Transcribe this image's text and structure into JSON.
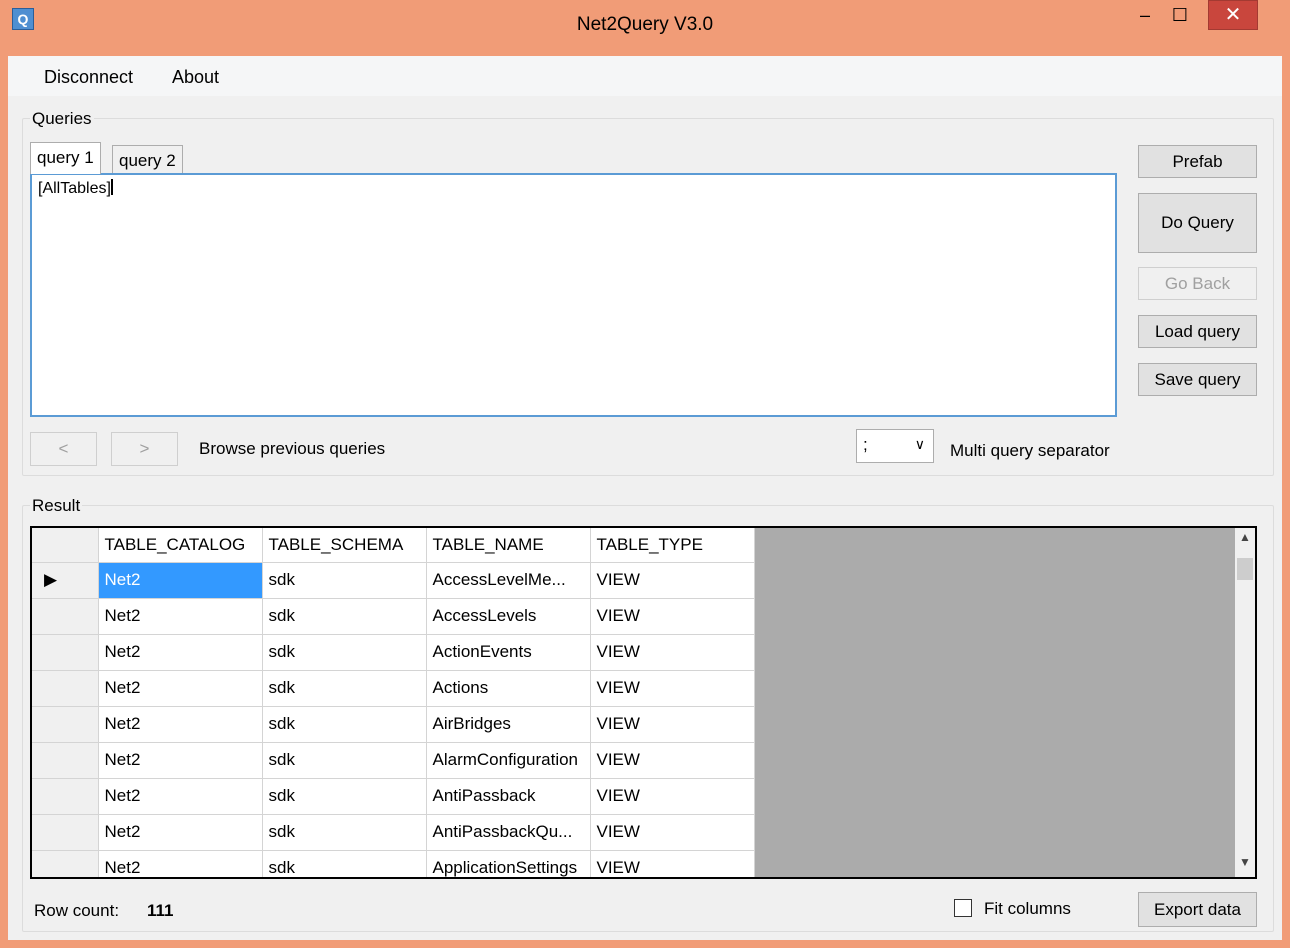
{
  "window": {
    "title": "Net2Query V3.0",
    "icon_letter": "Q",
    "min_glyph": "–",
    "max_glyph": "☐",
    "close_glyph": "✕"
  },
  "menu": {
    "items": [
      "Disconnect",
      "About"
    ]
  },
  "queries": {
    "group_label": "Queries",
    "tabs": [
      "query 1",
      "query 2"
    ],
    "active_tab": 0,
    "editor_text": "[AllTables]",
    "buttons": {
      "prefab": "Prefab",
      "do_query": "Do Query",
      "go_back": "Go Back",
      "load_query": "Load query",
      "save_query": "Save query"
    },
    "nav": {
      "prev": "<",
      "next": ">",
      "label": "Browse previous queries"
    },
    "separator": {
      "value": ";",
      "label": "Multi query separator"
    }
  },
  "result": {
    "group_label": "Result",
    "columns": [
      "TABLE_CATALOG",
      "TABLE_SCHEMA",
      "TABLE_NAME",
      "TABLE_TYPE"
    ],
    "rows": [
      [
        "Net2",
        "sdk",
        "AccessLevelMe...",
        "VIEW"
      ],
      [
        "Net2",
        "sdk",
        "AccessLevels",
        "VIEW"
      ],
      [
        "Net2",
        "sdk",
        "ActionEvents",
        "VIEW"
      ],
      [
        "Net2",
        "sdk",
        "Actions",
        "VIEW"
      ],
      [
        "Net2",
        "sdk",
        "AirBridges",
        "VIEW"
      ],
      [
        "Net2",
        "sdk",
        "AlarmConfiguration",
        "VIEW"
      ],
      [
        "Net2",
        "sdk",
        "AntiPassback",
        "VIEW"
      ],
      [
        "Net2",
        "sdk",
        "AntiPassbackQu...",
        "VIEW"
      ],
      [
        "Net2",
        "sdk",
        "ApplicationSettings",
        "VIEW"
      ]
    ],
    "current_row_marker": "▶",
    "row_count_label": "Row count:",
    "row_count": "111",
    "fit_columns_label": "Fit columns",
    "fit_columns_checked": false,
    "export_label": "Export data"
  },
  "colors": {
    "title_bar": "#f19c77",
    "close_button": "#c9463d",
    "selection": "#3399ff",
    "editor_border": "#5b9bd5",
    "grid_background": "#ababab"
  }
}
